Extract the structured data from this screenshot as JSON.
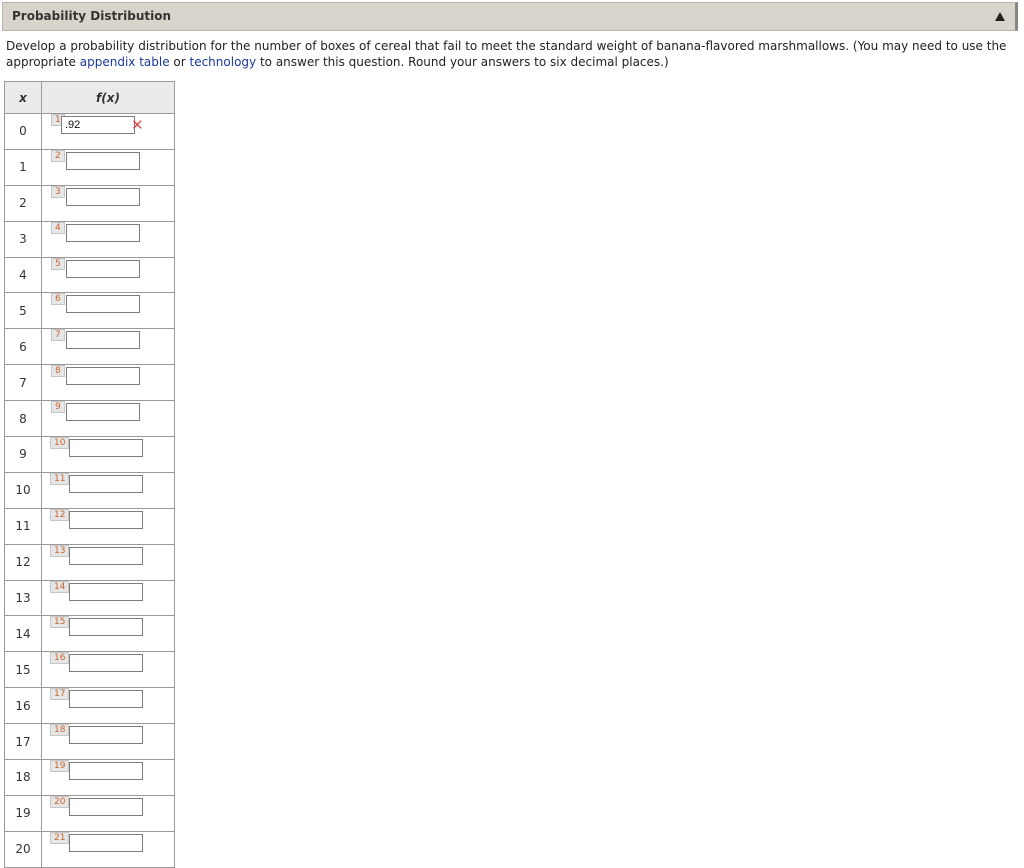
{
  "header": {
    "title": "Probability Distribution"
  },
  "question": {
    "text_before": "Develop a probability distribution for the number of boxes of cereal that fail to meet the standard weight of banana-flavored marshmallows. (You may need to use the appropriate ",
    "link_appendix": "appendix table",
    "text_or": " or ",
    "link_technology": "technology",
    "text_after": " to answer this question. Round your answers to six decimal places.)"
  },
  "table": {
    "col_x": "x",
    "col_fx": "f(x)",
    "rows": [
      {
        "x": "0",
        "n": "1",
        "value": ".92",
        "wrong": "✕"
      },
      {
        "x": "1",
        "n": "2",
        "value": ""
      },
      {
        "x": "2",
        "n": "3",
        "value": ""
      },
      {
        "x": "3",
        "n": "4",
        "value": ""
      },
      {
        "x": "4",
        "n": "5",
        "value": ""
      },
      {
        "x": "5",
        "n": "6",
        "value": ""
      },
      {
        "x": "6",
        "n": "7",
        "value": ""
      },
      {
        "x": "7",
        "n": "8",
        "value": ""
      },
      {
        "x": "8",
        "n": "9",
        "value": ""
      },
      {
        "x": "9",
        "n": "10",
        "value": ""
      },
      {
        "x": "10",
        "n": "11",
        "value": ""
      },
      {
        "x": "11",
        "n": "12",
        "value": ""
      },
      {
        "x": "12",
        "n": "13",
        "value": ""
      },
      {
        "x": "13",
        "n": "14",
        "value": ""
      },
      {
        "x": "14",
        "n": "15",
        "value": ""
      },
      {
        "x": "15",
        "n": "16",
        "value": ""
      },
      {
        "x": "16",
        "n": "17",
        "value": ""
      },
      {
        "x": "17",
        "n": "18",
        "value": ""
      },
      {
        "x": "18",
        "n": "19",
        "value": ""
      },
      {
        "x": "19",
        "n": "20",
        "value": ""
      },
      {
        "x": "20",
        "n": "21",
        "value": ""
      }
    ]
  },
  "colors": {
    "link": "#1a3a9c",
    "wrong_mark": "#e04b4b",
    "answer_number": "#c8652b"
  }
}
